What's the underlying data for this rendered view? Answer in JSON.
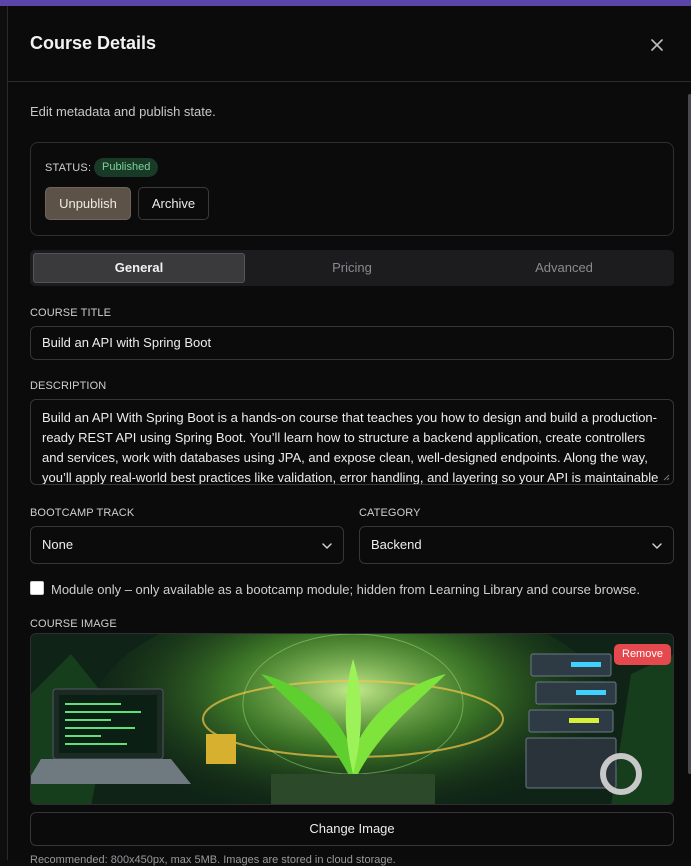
{
  "header": {
    "title": "Course Details",
    "close_icon": "close-icon"
  },
  "subtitle": "Edit metadata and publish state.",
  "status": {
    "label": "STATUS:",
    "badge": "Published",
    "unpublish_label": "Unpublish",
    "archive_label": "Archive"
  },
  "tabs": [
    {
      "label": "General",
      "active": true
    },
    {
      "label": "Pricing",
      "active": false
    },
    {
      "label": "Advanced",
      "active": false
    }
  ],
  "course_title": {
    "label": "COURSE TITLE",
    "value": "Build an API with Spring Boot"
  },
  "description": {
    "label": "DESCRIPTION",
    "value": "Build an API With Spring Boot is a hands-on course that teaches you how to design and build a production-ready REST API using Spring Boot. You’ll learn how to structure a backend application, create controllers and services, work with databases using JPA, and expose clean, well-designed endpoints. Along the way, you’ll apply real-world best practices like validation, error handling, and layering so your API is maintainable and scalable. By the end of the course, you’ll have a fully functional API and the confidence to build backend services on your own."
  },
  "bootcamp_track": {
    "label": "BOOTCAMP TRACK",
    "value": "None"
  },
  "category": {
    "label": "CATEGORY",
    "value": "Backend"
  },
  "module_only": {
    "checked": false,
    "label": "Module only – only available as a bootcamp module; hidden from Learning Library and course browse."
  },
  "course_image": {
    "label": "COURSE IMAGE",
    "remove_label": "Remove",
    "change_label": "Change Image",
    "hint": "Recommended: 800x450px, max 5MB. Images are stored in cloud storage."
  },
  "colors": {
    "accent_top": "#5b45a8",
    "unpublish_bg": "#5c5248",
    "published_badge_bg": "#183a26",
    "published_badge_text": "#7fd19a",
    "remove_bg": "#e5484d"
  }
}
